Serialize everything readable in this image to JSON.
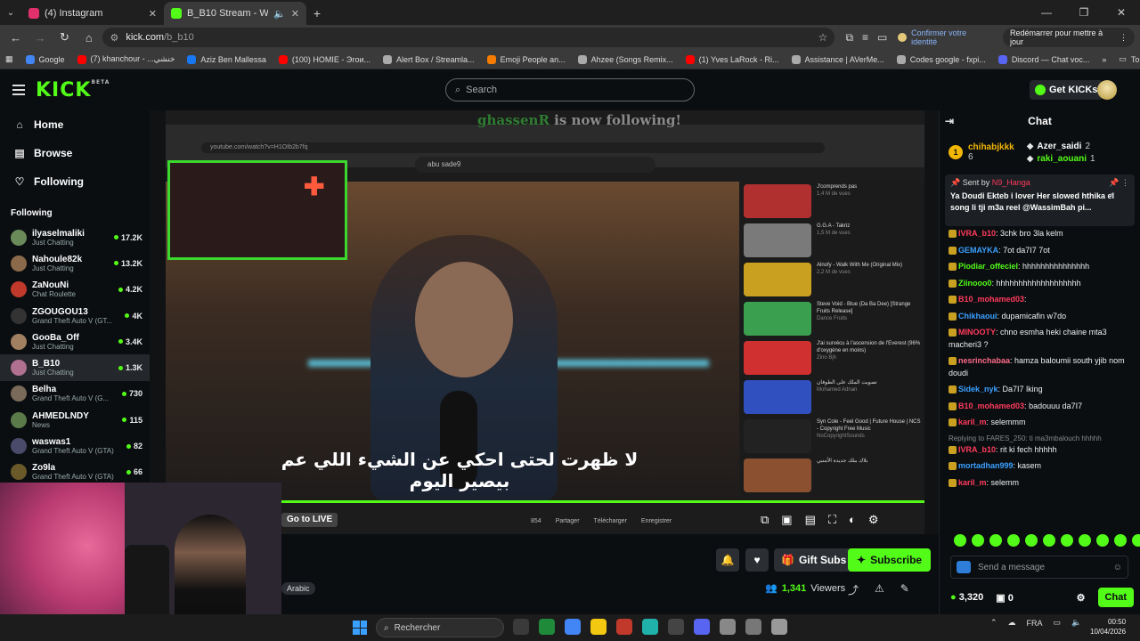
{
  "browser": {
    "tabs": [
      {
        "title": "(4) Instagram",
        "color": "#e1306c",
        "active": false
      },
      {
        "title": "B_B10 Stream - Watch Live",
        "color": "#53fc18",
        "active": true
      }
    ],
    "url_host": "kick.com",
    "url_path": "/b_b10",
    "confirm_identity": "Confirmer votre identité",
    "restart_label": "Redémarrer pour mettre à jour",
    "bookmarks": [
      {
        "label": "Google",
        "color": "#4285f4"
      },
      {
        "label": "(7) khanchour - ...خنشي",
        "color": "#ff0000"
      },
      {
        "label": "Aziz Ben Mallessa",
        "color": "#1877f2"
      },
      {
        "label": "(100) HOMIE - Эгои...",
        "color": "#ff0000"
      },
      {
        "label": "Alert Box / Streamla...",
        "color": "#aaaaaa"
      },
      {
        "label": "Emoji People an...",
        "color": "#f57c00"
      },
      {
        "label": "Ahzee (Songs Remix...",
        "color": "#aaaaaa"
      },
      {
        "label": "(1) Yves LaRock - Ri...",
        "color": "#ff0000"
      },
      {
        "label": "Assistance | AVerMe...",
        "color": "#aaaaaa"
      },
      {
        "label": "Codes google - fxpi...",
        "color": "#aaaaaa"
      },
      {
        "label": "Discord — Chat voc...",
        "color": "#5865f2"
      }
    ],
    "bookmarks_all": "Tous les favoris"
  },
  "header": {
    "logo": "KICK",
    "logo_sup": "BETA",
    "search_placeholder": "Search",
    "get_kicks": "Get KICKs"
  },
  "sidebar": {
    "nav": [
      {
        "label": "Home",
        "icon": "home-icon",
        "glyph": "⌂"
      },
      {
        "label": "Browse",
        "icon": "browse-icon",
        "glyph": "▤"
      },
      {
        "label": "Following",
        "icon": "heart-icon",
        "glyph": "♡"
      }
    ],
    "following_title": "Following",
    "channels": [
      {
        "name": "ilyaselmaliki",
        "category": "Just Chatting",
        "viewers": "17.2K",
        "color": "#6a8a5a",
        "active": false
      },
      {
        "name": "Nahoule82k",
        "category": "Just Chatting",
        "viewers": "13.2K",
        "color": "#8a6a4a",
        "active": false
      },
      {
        "name": "ZaNouNi",
        "category": "Chat Roulette",
        "viewers": "4.2K",
        "color": "#c0392b",
        "active": false
      },
      {
        "name": "ZGOUGOU13",
        "category": "Grand Theft Auto V (GT...",
        "viewers": "4K",
        "color": "#333333",
        "active": false
      },
      {
        "name": "GooBa_Off",
        "category": "Just Chatting",
        "viewers": "3.4K",
        "color": "#a08060",
        "active": false
      },
      {
        "name": "B_B10",
        "category": "Just Chatting",
        "viewers": "1.3K",
        "color": "#b07090",
        "active": true
      },
      {
        "name": "Belha",
        "category": "Grand Theft Auto V (G...",
        "viewers": "730",
        "color": "#7a6a5a",
        "active": false
      },
      {
        "name": "AHMEDLNDY",
        "category": "News",
        "viewers": "115",
        "color": "#5a7a4a",
        "active": false
      },
      {
        "name": "waswas1",
        "category": "Grand Theft Auto V (GTA)",
        "viewers": "82",
        "color": "#4a4a6a",
        "active": false
      },
      {
        "name": "Zo9la",
        "category": "Grand Theft Auto V (GTA)",
        "viewers": "66",
        "color": "#6a5a2a",
        "active": false
      }
    ]
  },
  "video": {
    "follow_user": "ghassenR",
    "follow_text": "is now following!",
    "inner_url": "youtube.com/watch?v=H1OIb2b7fq",
    "yt_search": "abu sade9",
    "subtitle": "لا ظهرت لحتى احكي عن الشيء اللي عم بيصير اليوم",
    "recommendations": [
      {
        "title": "J'comprends pas",
        "meta": "1,4 M de vues",
        "color": "#b03030"
      },
      {
        "title": "G.G.A - Takriz",
        "meta": "1,5 M de vues",
        "color": "#7a7a7a"
      },
      {
        "title": "Alnofy - Walk With Me (Original Mix)",
        "meta": "2,2 M de vues",
        "color": "#c9a020"
      },
      {
        "title": "Steve Void - Blue (Da Ba Dee) [Strange Fruits Release]",
        "meta": "Dance Fruits",
        "color": "#3aa050"
      },
      {
        "title": "J'ai survécu à l'ascension de l'Everest (96% d'oxygène en moins)",
        "meta": "Zino Bjh",
        "color": "#d03030"
      },
      {
        "title": "تصويت الملك على الطوفان",
        "meta": "Mohamed Adnan",
        "color": "#3050c0"
      },
      {
        "title": "Syn Cole - Feel Good | Future House | NCS - Copyright Free Music",
        "meta": "NoCopyrightSounds",
        "color": "#222222"
      },
      {
        "title": "بلاك ببلك جديدة الأمنبي",
        "meta": "",
        "color": "#8a5030"
      }
    ],
    "go_live": "Go to LIVE",
    "inner_actions": [
      "854",
      "Partager",
      "Télécharger",
      "Enregistrer"
    ]
  },
  "below": {
    "language": "Arabic",
    "gift_subs": "Gift Subs",
    "subscribe": "Subscribe",
    "viewers_count": "1,341",
    "viewers_label": "Viewers"
  },
  "chat": {
    "title": "Chat",
    "leaders": {
      "top_name": "chihabjkkk",
      "top_count": "6",
      "second_name": "Azer_saidi",
      "second_count": "2",
      "third_name": "raki_aouani",
      "third_count": "1"
    },
    "pinned": {
      "sent_by_label": "Sent by",
      "sent_by_user": "N9_Hanga",
      "message": "Ya Doudi Ekteb i lover Her slowed hthika el song li tji m3a reel @WassimBah pi..."
    },
    "messages": [
      {
        "reply": "",
        "user": "IVRA_b10",
        "color": "#ff3b5c",
        "text": "3chk bro 3la kelm"
      },
      {
        "reply": "",
        "user": "GEMAYKA",
        "color": "#3aa0ff",
        "text": "7ot da7I7 7ot"
      },
      {
        "reply": "",
        "user": "Piodiar_offeciel",
        "color": "#53fc18",
        "text": "hhhhhhhhhhhhhhh"
      },
      {
        "reply": "",
        "user": "Ziinooo0",
        "color": "#53fc18",
        "text": "hhhhhhhhhhhhhhhhhhh"
      },
      {
        "reply": "",
        "user": "B10_mohamed03",
        "color": "#ff3b5c",
        "text": ""
      },
      {
        "reply": "",
        "user": "Chikhaoui",
        "color": "#3aa0ff",
        "text": "dupamicafin w7do"
      },
      {
        "reply": "",
        "user": "MINOOTY",
        "color": "#ff3b5c",
        "text": "chno esmha heki chaine mta3 macheri3 ?"
      },
      {
        "reply": "",
        "user": "nesrinchabaa",
        "color": "#ff6b8a",
        "text": "hamza baloumii south yjib nom doudi"
      },
      {
        "reply": "",
        "user": "Sidek_nyk",
        "color": "#3aa0ff",
        "text": "Da7I7 lking"
      },
      {
        "reply": "",
        "user": "B10_mohamed03",
        "color": "#ff3b5c",
        "text": "badouuu da7I7"
      },
      {
        "reply": "",
        "user": "karil_m",
        "color": "#ff3b5c",
        "text": "selemmm"
      },
      {
        "reply": "Replying to FARES_250: ti ma3mbalouch hhhhh",
        "user": "IVRA_b10",
        "color": "#ff3b5c",
        "text": "rit ki fech hhhhh"
      },
      {
        "reply": "",
        "user": "mortadhan999",
        "color": "#3aa0ff",
        "text": "kasem"
      },
      {
        "reply": "",
        "user": "karil_m",
        "color": "#ff3b5c",
        "text": "selemm"
      }
    ],
    "input_placeholder": "Send a message",
    "kicks_count": "3,320",
    "points": "0",
    "chat_button": "Chat"
  },
  "taskbar": {
    "search_placeholder": "Rechercher",
    "lang": "FRA",
    "time": "00:50",
    "date": "10/04/2026",
    "apps": [
      "#3a3a3a",
      "#1f8a3a",
      "#4285f4",
      "#f2c811",
      "#c0392b",
      "#20b2aa",
      "#444444",
      "#5865f2",
      "#888888",
      "#777777",
      "#999999"
    ]
  }
}
